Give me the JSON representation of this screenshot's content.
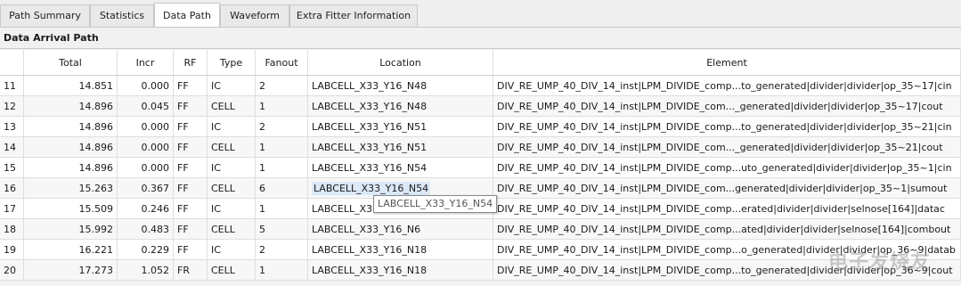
{
  "tabs": [
    "Path Summary",
    "Statistics",
    "Data Path",
    "Waveform",
    "Extra Fitter Information"
  ],
  "active_tab": "Data Path",
  "section_title": "Data Arrival Path",
  "columns": [
    "",
    "Total",
    "Incr",
    "RF",
    "Type",
    "Fanout",
    "Location",
    "Element"
  ],
  "rows": [
    [
      "11",
      "14.851",
      "0.000",
      "FF",
      "IC",
      "2",
      "LABCELL_X33_Y16_N48",
      "DIV_RE_UMP_40_DIV_14_inst|LPM_DIVIDE_comp...to_generated|divider|divider|op_35~17|cin"
    ],
    [
      "12",
      "14.896",
      "0.045",
      "FF",
      "CELL",
      "1",
      "LABCELL_X33_Y16_N48",
      "DIV_RE_UMP_40_DIV_14_inst|LPM_DIVIDE_com..._generated|divider|divider|op_35~17|cout"
    ],
    [
      "13",
      "14.896",
      "0.000",
      "FF",
      "IC",
      "2",
      "LABCELL_X33_Y16_N51",
      "DIV_RE_UMP_40_DIV_14_inst|LPM_DIVIDE_comp...to_generated|divider|divider|op_35~21|cin"
    ],
    [
      "14",
      "14.896",
      "0.000",
      "FF",
      "CELL",
      "1",
      "LABCELL_X33_Y16_N51",
      "DIV_RE_UMP_40_DIV_14_inst|LPM_DIVIDE_com..._generated|divider|divider|op_35~21|cout"
    ],
    [
      "15",
      "14.896",
      "0.000",
      "FF",
      "IC",
      "1",
      "LABCELL_X33_Y16_N54",
      "DIV_RE_UMP_40_DIV_14_inst|LPM_DIVIDE_comp...uto_generated|divider|divider|op_35~1|cin"
    ],
    [
      "16",
      "15.263",
      "0.367",
      "FF",
      "CELL",
      "6",
      "LABCELL_X33_Y16_N54",
      "DIV_RE_UMP_40_DIV_14_inst|LPM_DIVIDE_com...generated|divider|divider|op_35~1|sumout"
    ],
    [
      "17",
      "15.509",
      "0.246",
      "FF",
      "IC",
      "1",
      "LABCELL_X3",
      "DIV_RE_UMP_40_DIV_14_inst|LPM_DIVIDE_comp...erated|divider|divider|selnose[164]|datac"
    ],
    [
      "18",
      "15.992",
      "0.483",
      "FF",
      "CELL",
      "5",
      "LABCELL_X33_Y16_N6",
      "DIV_RE_UMP_40_DIV_14_inst|LPM_DIVIDE_comp...ated|divider|divider|selnose[164]|combout"
    ],
    [
      "19",
      "16.221",
      "0.229",
      "FF",
      "IC",
      "2",
      "LABCELL_X33_Y16_N18",
      "DIV_RE_UMP_40_DIV_14_inst|LPM_DIVIDE_comp...o_generated|divider|divider|op_36~9|datab"
    ],
    [
      "20",
      "17.273",
      "1.052",
      "FR",
      "CELL",
      "1",
      "LABCELL_X33_Y16_N18",
      "DIV_RE_UMP_40_DIV_14_inst|LPM_DIVIDE_comp...to_generated|divider|divider|op_36~9|cout"
    ]
  ],
  "highlighted_row_index": 5,
  "tooltip": "LABCELL_X33_Y16_N54",
  "watermark": "电子发烧友",
  "colors": {
    "highlight": "#dbe8f7",
    "tab_active": "#ffffff",
    "grid_line": "#dedede"
  }
}
